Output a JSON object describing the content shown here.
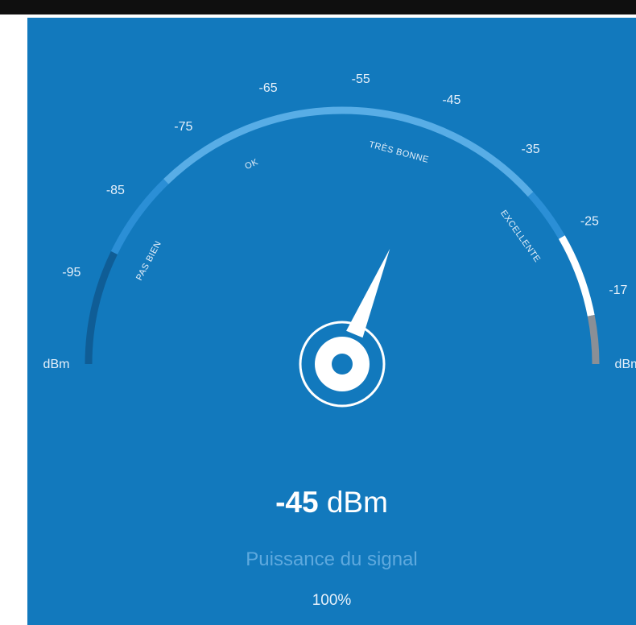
{
  "gauge": {
    "tick_labels": [
      {
        "text": "dBm",
        "value": -105
      },
      {
        "text": "-95",
        "value": -95
      },
      {
        "text": "-85",
        "value": -85
      },
      {
        "text": "-75",
        "value": -75
      },
      {
        "text": "-65",
        "value": -65
      },
      {
        "text": "-55",
        "value": -55
      },
      {
        "text": "-45",
        "value": -45
      },
      {
        "text": "-35",
        "value": -35
      },
      {
        "text": "-25",
        "value": -25
      },
      {
        "text": "-17",
        "value": -17
      },
      {
        "text": "dBm",
        "value": -9
      }
    ],
    "quality_labels": [
      {
        "text": "PAS BIEN",
        "value": -90
      },
      {
        "text": "OK",
        "value": -70
      },
      {
        "text": "TRÈS BONNE",
        "value": -49
      },
      {
        "text": "EXCELLENTE",
        "value": -28
      }
    ],
    "min_value": -105,
    "max_value": -9,
    "needle_value": -45,
    "colors": {
      "background": "#1279bd",
      "arc_dark": "#0f5d96",
      "arc_mid": "#2b8fd6",
      "arc_light": "#58ade6",
      "arc_white": "#ffffff",
      "arc_gray": "#8a8f96"
    }
  },
  "reading": {
    "value": "-45",
    "unit": " dBm"
  },
  "signal_label": "Puissance du signal",
  "percent": "100%"
}
